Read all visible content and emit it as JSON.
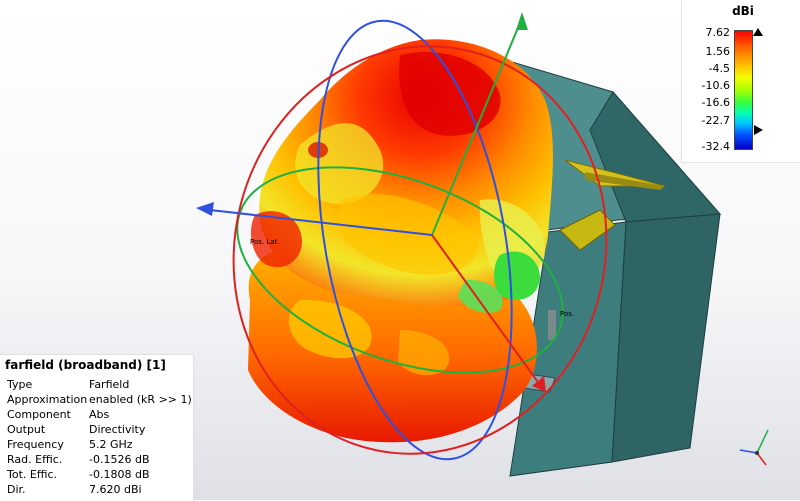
{
  "legend": {
    "unit": "dBi",
    "ticks": [
      "7.62",
      "1.56",
      "-4.5",
      "-10.6",
      "-16.6",
      "-22.7",
      "-32.4"
    ]
  },
  "info": {
    "title": "farfield (broadband) [1]",
    "rows": [
      {
        "label": "Type",
        "value": "Farfield"
      },
      {
        "label": "Approximation",
        "value": "enabled (kR >> 1)"
      },
      {
        "label": "Component",
        "value": "Abs"
      },
      {
        "label": "Output",
        "value": "Directivity"
      },
      {
        "label": "Frequency",
        "value": "5.2 GHz"
      },
      {
        "label": "Rad. Effic.",
        "value": "-0.1526 dB"
      },
      {
        "label": "Tot. Effic.",
        "value": "-0.1808 dB"
      },
      {
        "label": "Dir.",
        "value": "7.620 dBi"
      }
    ]
  },
  "scene": {
    "labels": [
      "Pos. Lat.",
      "Pos."
    ],
    "colors": {
      "max": "#ff0000",
      "high": "#ff8c00",
      "mid": "#f2e52a",
      "low": "#3cdc3c",
      "axis_x": "#3050e0",
      "axis_y": "#20b040",
      "axis_z": "#e02020",
      "enclosure": "#2e6a6a"
    }
  }
}
